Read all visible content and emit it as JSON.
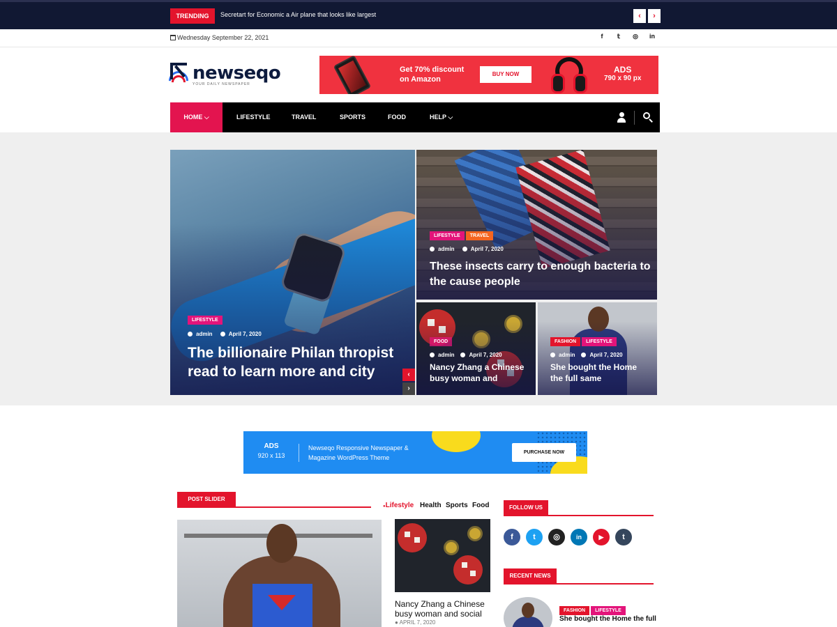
{
  "topbar": {
    "trending_label": "TRENDING",
    "trending_text": "Secretart for Economic a Air plane that looks like largest",
    "prev_icon": "chevron-left-icon",
    "next_icon": "chevron-right-icon"
  },
  "date_bar": {
    "date": "Wednesday September 22, 2021",
    "social": [
      "f",
      "𝕥",
      "◎",
      "in"
    ]
  },
  "header": {
    "logo_name": "newseqo",
    "logo_tagline": "YOUR DAILY NEWSPAPER",
    "ad": {
      "promo_line1": "Get 70% discount",
      "promo_line2": "on Amazon",
      "button": "BUY NOW",
      "label": "ADS",
      "size": "790 x 90 px"
    }
  },
  "nav": {
    "items": [
      {
        "label": "HOME",
        "has_dropdown": true
      },
      {
        "label": "LIFESTYLE"
      },
      {
        "label": "TRAVEL"
      },
      {
        "label": "SPORTS"
      },
      {
        "label": "FOOD"
      },
      {
        "label": "HELP",
        "has_dropdown": true
      }
    ],
    "dropdown_glyph": "⌵",
    "colors": {
      "active": "#e3144f",
      "bar": "#000000"
    }
  },
  "hero": {
    "main": {
      "category": "LIFESTYLE",
      "author": "admin",
      "date": "April 7, 2020",
      "title": "The billionaire Philan thropist read to learn more and city"
    },
    "top_right": {
      "categories": [
        "LIFESTYLE",
        "TRAVEL"
      ],
      "author": "admin",
      "date": "April 7, 2020",
      "title": "These insects carry to enough bacteria to the cause people"
    },
    "bottom_left": {
      "category": "FOOD",
      "author": "admin",
      "date": "April 7, 2020",
      "title": "Nancy Zhang a Chinese busy woman and"
    },
    "bottom_right": {
      "categories": [
        "FASHION",
        "LIFESTYLE"
      ],
      "author": "admin",
      "date": "April 7, 2020",
      "title": "She bought the Home the full same"
    },
    "prev": "‹",
    "next": "›"
  },
  "ad2": {
    "label": "ADS",
    "size": "920 x 113",
    "text": "Newseqo Responsive Newspaper & Magazine WordPress Theme",
    "button": "PURCHASE NOW"
  },
  "post_slider": {
    "title": "POST SLIDER",
    "filters": [
      "Lifestyle",
      "Health",
      "Sports",
      "Food"
    ],
    "side_post": {
      "title": "Nancy Zhang a Chinese busy woman and social",
      "date": "APRIL 7, 2020"
    }
  },
  "sidebar": {
    "follow_title": "FOLLOW US",
    "follow_icons": [
      {
        "name": "facebook-icon",
        "glyph": "f",
        "color": "#3b5998"
      },
      {
        "name": "twitter-icon",
        "glyph": "t",
        "color": "#1da1f2"
      },
      {
        "name": "instagram-icon",
        "glyph": "◎",
        "color": "#222222"
      },
      {
        "name": "linkedin-icon",
        "glyph": "in",
        "color": "#0077b5"
      },
      {
        "name": "youtube-icon",
        "glyph": "▶",
        "color": "#e3142c"
      },
      {
        "name": "tumblr-icon",
        "glyph": "t",
        "color": "#35465c"
      }
    ],
    "recent_title": "RECENT NEWS",
    "recent_post": {
      "categories": [
        "FASHION",
        "LIFESTYLE"
      ],
      "title": "She bought the Home the full"
    }
  }
}
